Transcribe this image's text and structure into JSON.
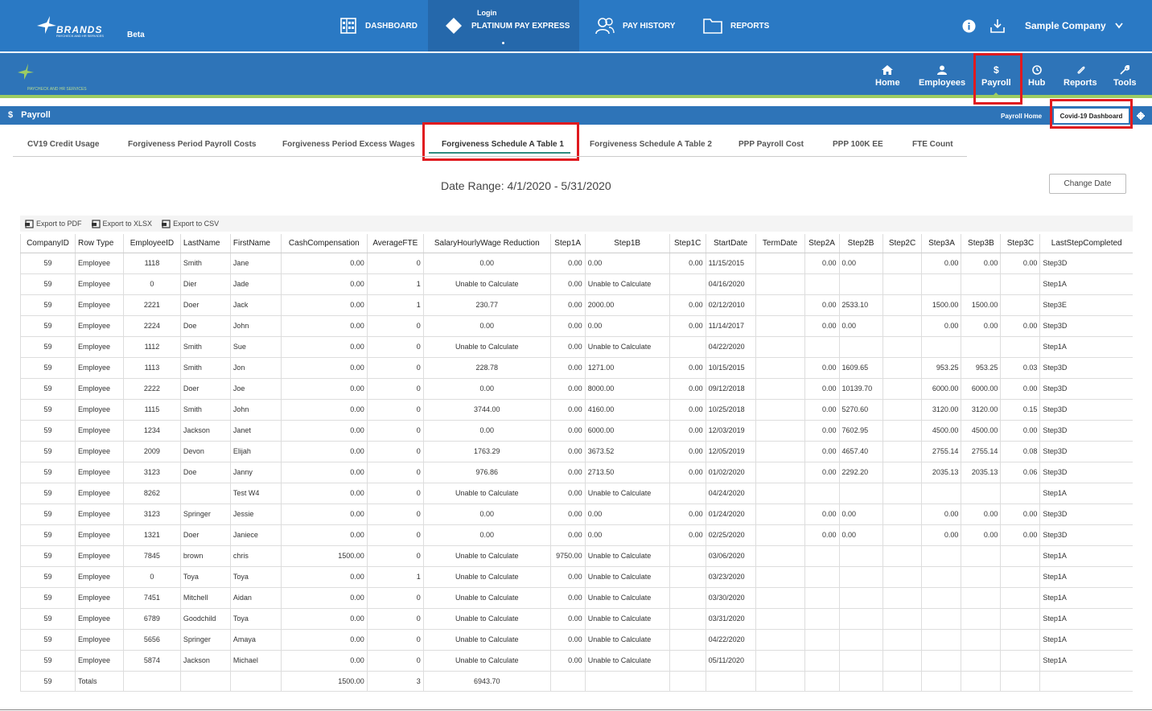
{
  "topbar": {
    "logo_text": "BRANDS",
    "logo_sub": "PAYCHECK AND HR SERVICES",
    "beta": "Beta",
    "nav": [
      {
        "label": "DASHBOARD",
        "icon": "dashboard-icon"
      },
      {
        "label": "PLATINUM PAY EXPRESS",
        "icon": "platinum-icon",
        "sublabel": "Login"
      },
      {
        "label": "PAY HISTORY",
        "icon": "pay-history-icon"
      },
      {
        "label": "REPORTS",
        "icon": "folder-icon"
      }
    ],
    "company": "Sample Company"
  },
  "secondary_nav": {
    "logo_sub": "PAYCHECK AND HR SERVICES",
    "items": [
      {
        "label": "Home",
        "icon": "home-icon"
      },
      {
        "label": "Employees",
        "icon": "user-icon"
      },
      {
        "label": "Payroll",
        "icon": "dollar-icon"
      },
      {
        "label": "Hub",
        "icon": "clock-icon"
      },
      {
        "label": "Reports",
        "icon": "paperclip-icon"
      },
      {
        "label": "Tools",
        "icon": "wrench-icon"
      }
    ]
  },
  "page_bar": {
    "symbol": "$",
    "title": "Payroll",
    "payroll_home": "Payroll Home",
    "covid_dashboard": "Covid-19 Dashboard"
  },
  "tabs": [
    "CV19 Credit Usage",
    "Forgiveness Period Payroll Costs",
    "Forgiveness Period Excess Wages",
    "Forgiveness Schedule A Table 1",
    "Forgiveness Schedule A Table 2",
    "PPP Payroll Cost",
    "PPP 100K EE",
    "FTE Count"
  ],
  "active_tab": "Forgiveness Schedule A Table 1",
  "date_range": "Date Range: 4/1/2020 - 5/31/2020",
  "change_date": "Change Date",
  "exports": [
    "Export to PDF",
    "Export to XLSX",
    "Export to CSV"
  ],
  "table": {
    "columns": [
      "CompanyID",
      "Row Type",
      "EmployeeID",
      "LastName",
      "FirstName",
      "CashCompensation",
      "AverageFTE",
      "SalaryHourlyWage Reduction",
      "Step1A",
      "Step1B",
      "Step1C",
      "StartDate",
      "TermDate",
      "Step2A",
      "Step2B",
      "Step2C",
      "Step3A",
      "Step3B",
      "Step3C",
      "LastStepCompleted"
    ],
    "rows": [
      [
        "59",
        "Employee",
        "1118",
        "Smith",
        "Jane",
        "0.00",
        "0",
        "0.00",
        "0.00",
        "0.00",
        "0.00",
        "11/15/2015",
        "",
        "0.00",
        "0.00",
        "",
        "0.00",
        "0.00",
        "0.00",
        "Step3D"
      ],
      [
        "59",
        "Employee",
        "0",
        "Dier",
        "Jade",
        "0.00",
        "1",
        "Unable to Calculate",
        "0.00",
        "Unable to Calculate",
        "",
        "04/16/2020",
        "",
        "",
        "",
        "",
        "",
        "",
        "",
        "Step1A"
      ],
      [
        "59",
        "Employee",
        "2221",
        "Doer",
        "Jack",
        "0.00",
        "1",
        "230.77",
        "0.00",
        "2000.00",
        "0.00",
        "02/12/2010",
        "",
        "0.00",
        "2533.10",
        "",
        "1500.00",
        "1500.00",
        "",
        "Step3E"
      ],
      [
        "59",
        "Employee",
        "2224",
        "Doe",
        "John",
        "0.00",
        "0",
        "0.00",
        "0.00",
        "0.00",
        "0.00",
        "11/14/2017",
        "",
        "0.00",
        "0.00",
        "",
        "0.00",
        "0.00",
        "0.00",
        "Step3D"
      ],
      [
        "59",
        "Employee",
        "1112",
        "Smith",
        "Sue",
        "0.00",
        "0",
        "Unable to Calculate",
        "0.00",
        "Unable to Calculate",
        "",
        "04/22/2020",
        "",
        "",
        "",
        "",
        "",
        "",
        "",
        "Step1A"
      ],
      [
        "59",
        "Employee",
        "1113",
        "Smith",
        "Jon",
        "0.00",
        "0",
        "228.78",
        "0.00",
        "1271.00",
        "0.00",
        "10/15/2015",
        "",
        "0.00",
        "1609.65",
        "",
        "953.25",
        "953.25",
        "0.03",
        "Step3D"
      ],
      [
        "59",
        "Employee",
        "2222",
        "Doer",
        "Joe",
        "0.00",
        "0",
        "0.00",
        "0.00",
        "8000.00",
        "0.00",
        "09/12/2018",
        "",
        "0.00",
        "10139.70",
        "",
        "6000.00",
        "6000.00",
        "0.00",
        "Step3D"
      ],
      [
        "59",
        "Employee",
        "1115",
        "Smith",
        "John",
        "0.00",
        "0",
        "3744.00",
        "0.00",
        "4160.00",
        "0.00",
        "10/25/2018",
        "",
        "0.00",
        "5270.60",
        "",
        "3120.00",
        "3120.00",
        "0.15",
        "Step3D"
      ],
      [
        "59",
        "Employee",
        "1234",
        "Jackson",
        "Janet",
        "0.00",
        "0",
        "0.00",
        "0.00",
        "6000.00",
        "0.00",
        "12/03/2019",
        "",
        "0.00",
        "7602.95",
        "",
        "4500.00",
        "4500.00",
        "0.00",
        "Step3D"
      ],
      [
        "59",
        "Employee",
        "2009",
        "Devon",
        "Elijah",
        "0.00",
        "0",
        "1763.29",
        "0.00",
        "3673.52",
        "0.00",
        "12/05/2019",
        "",
        "0.00",
        "4657.40",
        "",
        "2755.14",
        "2755.14",
        "0.08",
        "Step3D"
      ],
      [
        "59",
        "Employee",
        "3123",
        "Doe",
        "Janny",
        "0.00",
        "0",
        "976.86",
        "0.00",
        "2713.50",
        "0.00",
        "01/02/2020",
        "",
        "0.00",
        "2292.20",
        "",
        "2035.13",
        "2035.13",
        "0.06",
        "Step3D"
      ],
      [
        "59",
        "Employee",
        "8262",
        "",
        "Test W4",
        "0.00",
        "0",
        "Unable to Calculate",
        "0.00",
        "Unable to Calculate",
        "",
        "04/24/2020",
        "",
        "",
        "",
        "",
        "",
        "",
        "",
        "Step1A"
      ],
      [
        "59",
        "Employee",
        "3123",
        "Springer",
        "Jessie",
        "0.00",
        "0",
        "0.00",
        "0.00",
        "0.00",
        "0.00",
        "01/24/2020",
        "",
        "0.00",
        "0.00",
        "",
        "0.00",
        "0.00",
        "0.00",
        "Step3D"
      ],
      [
        "59",
        "Employee",
        "1321",
        "Doer",
        "Janiece",
        "0.00",
        "0",
        "0.00",
        "0.00",
        "0.00",
        "0.00",
        "02/25/2020",
        "",
        "0.00",
        "0.00",
        "",
        "0.00",
        "0.00",
        "0.00",
        "Step3D"
      ],
      [
        "59",
        "Employee",
        "7845",
        "brown",
        "chris",
        "1500.00",
        "0",
        "Unable to Calculate",
        "9750.00",
        "Unable to Calculate",
        "",
        "03/06/2020",
        "",
        "",
        "",
        "",
        "",
        "",
        "",
        "Step1A"
      ],
      [
        "59",
        "Employee",
        "0",
        "Toya",
        "Toya",
        "0.00",
        "1",
        "Unable to Calculate",
        "0.00",
        "Unable to Calculate",
        "",
        "03/23/2020",
        "",
        "",
        "",
        "",
        "",
        "",
        "",
        "Step1A"
      ],
      [
        "59",
        "Employee",
        "7451",
        "Mitchell",
        "Aidan",
        "0.00",
        "0",
        "Unable to Calculate",
        "0.00",
        "Unable to Calculate",
        "",
        "03/30/2020",
        "",
        "",
        "",
        "",
        "",
        "",
        "",
        "Step1A"
      ],
      [
        "59",
        "Employee",
        "6789",
        "Goodchild",
        "Toya",
        "0.00",
        "0",
        "Unable to Calculate",
        "0.00",
        "Unable to Calculate",
        "",
        "03/31/2020",
        "",
        "",
        "",
        "",
        "",
        "",
        "",
        "Step1A"
      ],
      [
        "59",
        "Employee",
        "5656",
        "Springer",
        "Amaya",
        "0.00",
        "0",
        "Unable to Calculate",
        "0.00",
        "Unable to Calculate",
        "",
        "04/22/2020",
        "",
        "",
        "",
        "",
        "",
        "",
        "",
        "Step1A"
      ],
      [
        "59",
        "Employee",
        "5874",
        "Jackson",
        "Michael",
        "0.00",
        "0",
        "Unable to Calculate",
        "0.00",
        "Unable to Calculate",
        "",
        "05/11/2020",
        "",
        "",
        "",
        "",
        "",
        "",
        "",
        "Step1A"
      ]
    ],
    "totals": [
      "59",
      "Totals",
      "",
      "",
      "",
      "1500.00",
      "3",
      "6943.70",
      "",
      "",
      "",
      "",
      "",
      "",
      "",
      "",
      "",
      "",
      "",
      ""
    ]
  }
}
